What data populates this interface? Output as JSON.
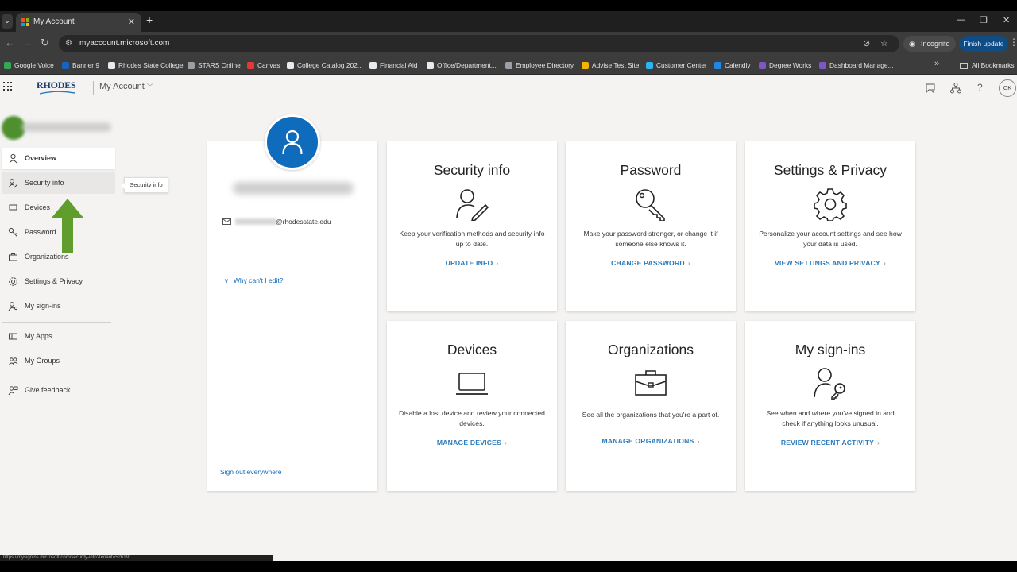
{
  "browser": {
    "tab_title": "My Account",
    "url": "myaccount.microsoft.com",
    "incognito_label": "Incognito",
    "finish_update_label": "Finish update",
    "bookmarks": [
      {
        "label": "Google Voice",
        "color": "#34a853"
      },
      {
        "label": "Banner 9",
        "color": "#1565c0"
      },
      {
        "label": "Rhodes State College",
        "color": "#e8eaed"
      },
      {
        "label": "STARS Online",
        "color": "#9aa0a6"
      },
      {
        "label": "Canvas",
        "color": "#e53935"
      },
      {
        "label": "College Catalog 202...",
        "color": "#e8eaed"
      },
      {
        "label": "Financial Aid",
        "color": "#e8eaed"
      },
      {
        "label": "Office/Department...",
        "color": "#e8eaed"
      },
      {
        "label": "Employee Directory",
        "color": "#9aa0a6"
      },
      {
        "label": "Advise Test Site",
        "color": "#f4b400"
      },
      {
        "label": "Customer Center",
        "color": "#29b6f6"
      },
      {
        "label": "Calendly",
        "color": "#1e88e5"
      },
      {
        "label": "Degree Works",
        "color": "#7e57c2"
      },
      {
        "label": "Dashboard Manage...",
        "color": "#7e57c2"
      }
    ],
    "all_bookmarks_label": "All Bookmarks",
    "status_url": "https://mysignins.microsoft.com/security-info?tenant=526191..."
  },
  "header": {
    "logo_text": "RHODES",
    "app_title": "My Account",
    "avatar_initials": "CK"
  },
  "sidebar": {
    "items": [
      {
        "label": "Overview"
      },
      {
        "label": "Security info"
      },
      {
        "label": "Devices"
      },
      {
        "label": "Password"
      },
      {
        "label": "Organizations"
      },
      {
        "label": "Settings & Privacy"
      },
      {
        "label": "My sign-ins"
      },
      {
        "label": "My Apps"
      },
      {
        "label": "My Groups"
      },
      {
        "label": "Give feedback"
      }
    ],
    "tooltip": "Security info"
  },
  "profile": {
    "email_domain": "@rhodesstate.edu",
    "why_cant_edit": "Why can't I edit?",
    "sign_out_everywhere": "Sign out everywhere"
  },
  "cards": [
    {
      "title": "Security info",
      "desc": "Keep your verification methods and security info up to date.",
      "link": "UPDATE INFO",
      "icon": "person-pen-icon"
    },
    {
      "title": "Password",
      "desc": "Make your password stronger, or change it if someone else knows it.",
      "link": "CHANGE PASSWORD",
      "icon": "key-icon"
    },
    {
      "title": "Settings & Privacy",
      "desc": "Personalize your account settings and see how your data is used.",
      "link": "VIEW SETTINGS AND PRIVACY",
      "icon": "gear-icon"
    },
    {
      "title": "Devices",
      "desc": "Disable a lost device and review your connected devices.",
      "link": "MANAGE DEVICES",
      "icon": "laptop-icon"
    },
    {
      "title": "Organizations",
      "desc": "See all the organizations that you're a part of.",
      "link": "MANAGE ORGANIZATIONS",
      "icon": "briefcase-icon"
    },
    {
      "title": "My sign-ins",
      "desc": "See when and where you've signed in and check if anything looks unusual.",
      "link": "REVIEW RECENT ACTIVITY",
      "icon": "person-key-icon"
    }
  ],
  "colors": {
    "accent": "#0f6cbd",
    "link": "#2b7bbd",
    "arrow": "#5f9e2c",
    "page_bg": "#f4f3f2"
  }
}
